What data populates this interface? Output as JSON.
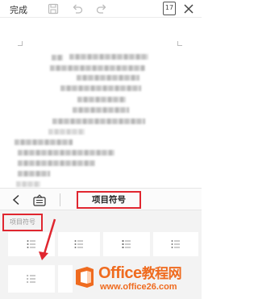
{
  "toolbar": {
    "done_label": "完成",
    "page_count": "17",
    "icons": [
      "save-icon",
      "undo-icon",
      "redo-icon",
      "page-count-icon",
      "close-icon"
    ]
  },
  "format_bar": {
    "panel_title": "项目符号",
    "icons": [
      "back-icon",
      "keyboard-icon"
    ]
  },
  "list_panel": {
    "section_label": "项目符号",
    "options": [
      "bullet-list-style",
      "bullet-list-style",
      "bullet-list-style",
      "bullet-list-style",
      "bullet-list-style"
    ]
  },
  "watermark": {
    "brand": "Office",
    "brand_cn": "教程网",
    "site": "www.office26.com"
  },
  "colors": {
    "highlight": "#e0262f",
    "brand": "#ef6b1f",
    "selection": "#3a8ef0"
  }
}
